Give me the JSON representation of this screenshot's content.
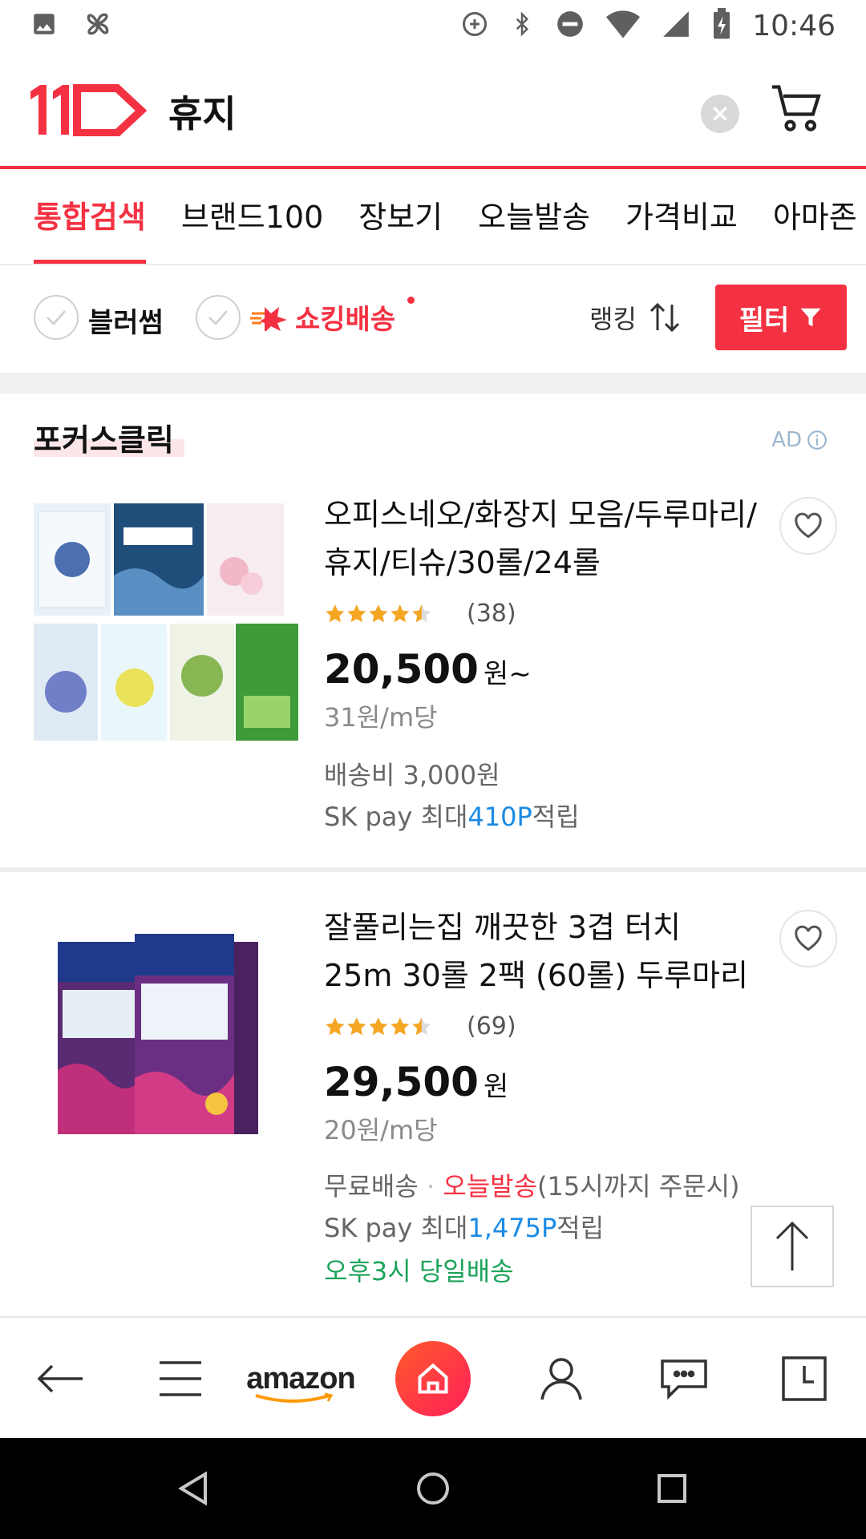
{
  "status_bar": {
    "time": "10:46",
    "icons": [
      "image-icon",
      "pinwheel-icon",
      "data-saver-icon",
      "bluetooth-icon",
      "do-not-disturb-icon",
      "wifi-icon",
      "cellular-icon",
      "battery-charging-icon"
    ]
  },
  "header": {
    "logo_text": "11",
    "query": "휴지",
    "colors": {
      "brand": "#f43142"
    }
  },
  "tabs": [
    {
      "label": "통합검색",
      "active": true
    },
    {
      "label": "브랜드100",
      "active": false
    },
    {
      "label": "장보기",
      "active": false
    },
    {
      "label": "오늘발송",
      "active": false
    },
    {
      "label": "가격비교",
      "active": false
    },
    {
      "label": "아마존",
      "active": false
    }
  ],
  "filters": {
    "check1_label": "블러썸",
    "check2_label": "쇼킹배송",
    "sort_label": "랭킹",
    "filter_button": "필터"
  },
  "section": {
    "title": "포커스클릭",
    "ad_label": "AD"
  },
  "products": [
    {
      "title": "오피스네오/화장지 모음/두루마리/휴지/티슈/30롤/24롤",
      "rating": 4.5,
      "review_count": "(38)",
      "price": "20,500",
      "price_unit": "원~",
      "unit_price": "31원/m당",
      "shipping": "배송비 3,000원",
      "points_prefix": "SK pay 최대",
      "points_value": "410P",
      "points_suffix": "적립"
    },
    {
      "title": "잘풀리는집 깨끗한 3겹 터치 25m 30롤 2팩 (60롤) 두루마리",
      "rating": 4.5,
      "review_count": "(69)",
      "price": "29,500",
      "price_unit": "원",
      "unit_price": "20원/m당",
      "shipping_free": "무료배송",
      "shipping_sep": " · ",
      "today_ship": "오늘발송",
      "today_ship_note": "(15시까지 주문시)",
      "points_prefix": "SK pay 최대",
      "points_value": "1,475P",
      "points_suffix": "적립",
      "same_day": "오후3시 당일배송"
    }
  ],
  "bottom_nav": {
    "amazon_label": "amazon",
    "items": [
      "back-icon",
      "menu-icon",
      "amazon-logo",
      "home-icon",
      "user-icon",
      "chat-icon",
      "recent-icon"
    ]
  }
}
